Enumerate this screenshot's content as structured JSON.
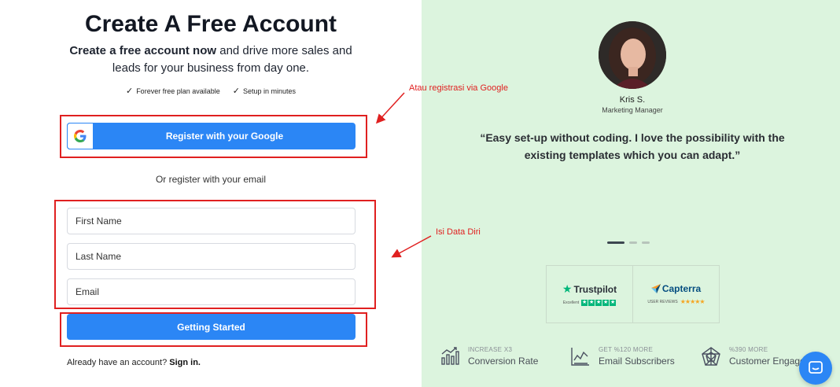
{
  "left": {
    "title": "Create A Free Account",
    "subtitle_bold": "Create a free account now",
    "subtitle_rest": " and drive more sales and leads for your business from day one.",
    "perks": [
      "Forever free plan available",
      "Setup in minutes"
    ],
    "google_button_label": "Register with your Google",
    "or_text": "Or register with your email",
    "fields": {
      "first_name_placeholder": "First Name",
      "last_name_placeholder": "Last Name",
      "email_placeholder": "Email"
    },
    "submit_label": "Getting Started",
    "signin_prefix": "Already have an account?",
    "signin_link": "Sign in."
  },
  "annotations": {
    "google_note": "Atau registrasi via Google",
    "data_note": "Isi Data Diri",
    "color": "#e02020"
  },
  "right": {
    "reviewer_name": "Kris S.",
    "reviewer_role": "Marketing Manager",
    "quote": "“Easy set-up without coding. I love the possibility with the existing templates which you can adapt.”",
    "carousel_active_index": 0,
    "carousel_count": 3,
    "badges": {
      "trustpilot_name": "Trustpilot",
      "trustpilot_rating": "Excellent",
      "capterra_name": "Capterra",
      "capterra_rating": "USER REVIEWS"
    },
    "stats": [
      {
        "small": "INCREASE X3",
        "big": "Conversion Rate",
        "icon": "bar-chart-icon"
      },
      {
        "small": "GET %120 MORE",
        "big": "Email Subscribers",
        "icon": "line-chart-icon"
      },
      {
        "small": "%390 MORE",
        "big": "Customer Engagement",
        "icon": "radar-chart-icon"
      }
    ]
  },
  "colors": {
    "primary": "#2b86f5",
    "right_bg": "#dcf4de",
    "annotation": "#e02020"
  }
}
